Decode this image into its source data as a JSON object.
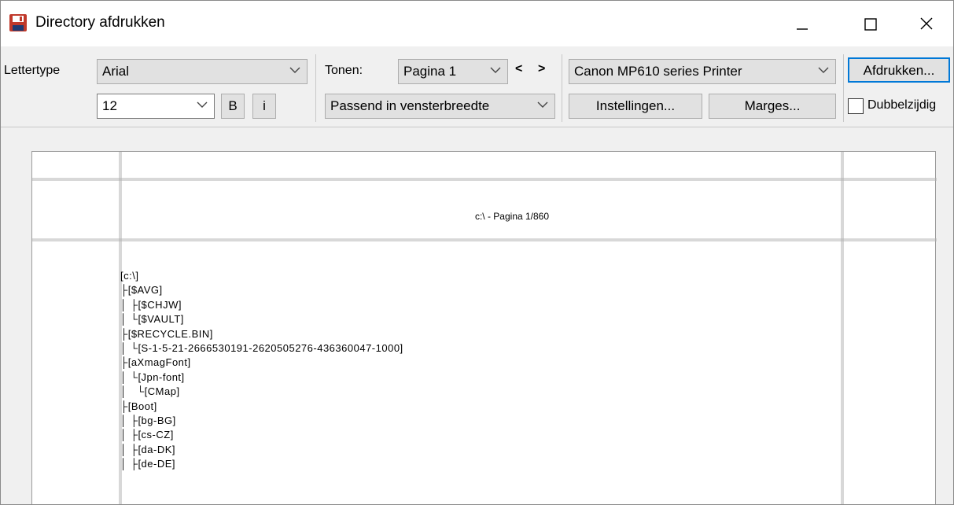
{
  "window": {
    "title": "Directory afdrukken"
  },
  "toolbar": {
    "font_label": "Lettertype",
    "font_value": "Arial",
    "size_value": "12",
    "bold_label": "B",
    "italic_label": "i",
    "tonen_label": "Tonen:",
    "page_value": "Pagina 1",
    "prev_label": "<",
    "next_label": ">",
    "fit_value": "Passend in vensterbreedte",
    "printer_value": "Canon MP610 series Printer",
    "settings_label": "Instellingen...",
    "margins_label": "Marges...",
    "print_label": "Afdrukken...",
    "duplex_label": "Dubbelzijdig"
  },
  "preview": {
    "page_title": "c:\\ - Pagina 1/860",
    "tree": [
      "[c:\\]",
      "├[$AVG]",
      "│ ├[$CHJW]",
      "│ └[$VAULT]",
      "├[$RECYCLE.BIN]",
      "│ └[S-1-5-21-2666530191-2620505276-436360047-1000]",
      "├[aXmagFont]",
      "│ └[Jpn-font]",
      "│   └[CMap]",
      "├[Boot]",
      "│ ├[bg-BG]",
      "│ ├[cs-CZ]",
      "│ ├[da-DK]",
      "│ ├[de-DE]"
    ]
  },
  "colors": {
    "accent": "#0078d7",
    "icon_red": "#c0392b",
    "toolbar_bg": "#f0f0f0"
  }
}
